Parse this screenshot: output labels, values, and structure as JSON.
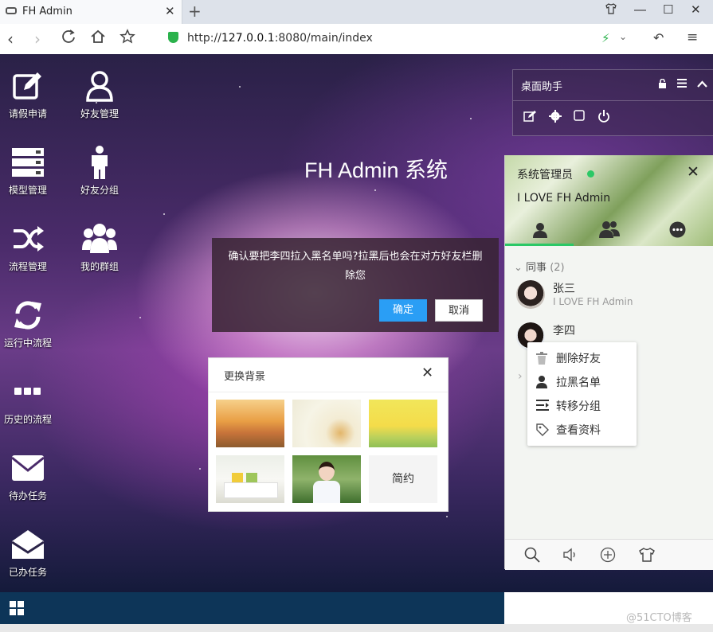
{
  "browser": {
    "tab_title": "FH Admin",
    "new_tab": "+",
    "url_prefix": "http://",
    "url_host": "127.0.0.1",
    "url_rest": ":8080/main/index"
  },
  "desktop": {
    "title": "FH Admin 系统",
    "icons": [
      {
        "label": "请假申请",
        "icon": "edit-icon"
      },
      {
        "label": "好友管理",
        "icon": "user-icon"
      },
      {
        "label": "模型管理",
        "icon": "server-icon"
      },
      {
        "label": "好友分组",
        "icon": "person-icon"
      },
      {
        "label": "流程管理",
        "icon": "shuffle-icon"
      },
      {
        "label": "我的群组",
        "icon": "group-icon"
      },
      {
        "label": "运行中流程",
        "icon": "refresh-icon"
      },
      {
        "label": "历史的流程",
        "icon": "more-icon"
      },
      {
        "label": "待办任务",
        "icon": "envelope-icon"
      },
      {
        "label": "已办任务",
        "icon": "envelope-open-icon"
      }
    ]
  },
  "helper": {
    "title": "桌面助手"
  },
  "confirm": {
    "message": "确认要把李四拉入黑名单吗?拉黑后也会在对方好友栏删除您",
    "ok_label": "确定",
    "cancel_label": "取消"
  },
  "bg_panel": {
    "title": "更换背景",
    "simple_label": "简约"
  },
  "chat": {
    "username": "系统管理员",
    "signature": "I LOVE FH Admin",
    "group_name": "同事",
    "group_count": "(2)",
    "contacts": [
      {
        "name": "张三",
        "sign": "I LOVE FH Admin"
      },
      {
        "name": "李四",
        "sign": ""
      }
    ],
    "context_menu": [
      "删除好友",
      "拉黑名单",
      "转移分组",
      "查看资料"
    ]
  },
  "watermark": "@51CTO博客",
  "colors": {
    "accent": "#2a9ef5",
    "online": "#2bc866",
    "taskbar": "#0d3558"
  }
}
